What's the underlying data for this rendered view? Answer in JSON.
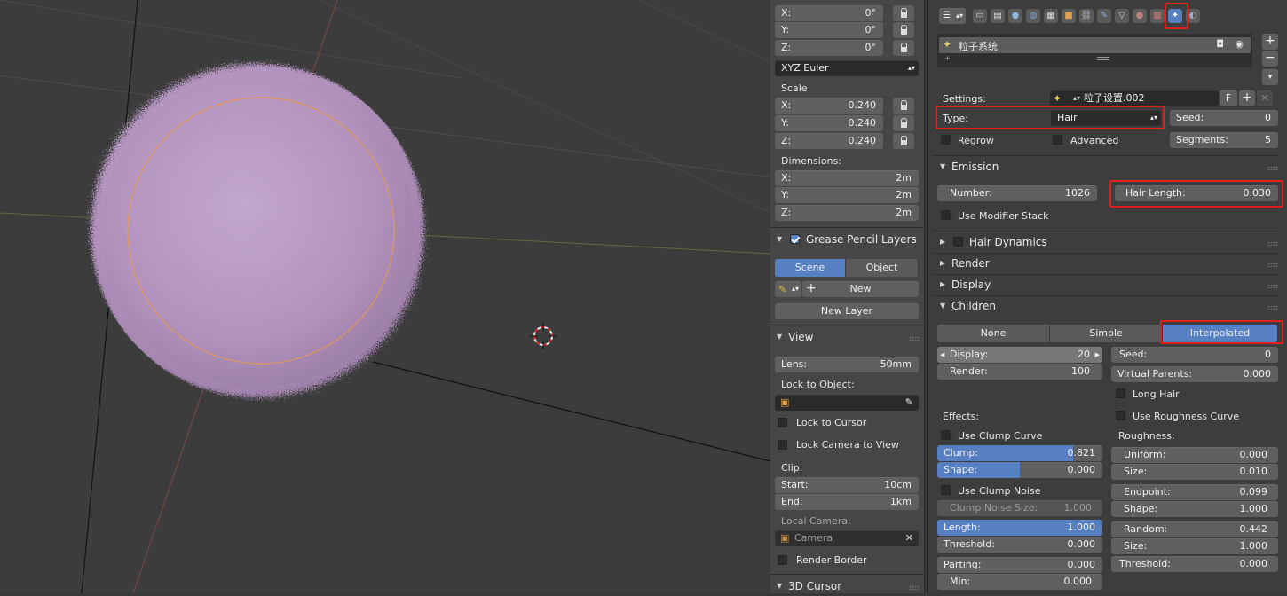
{
  "npanel": {
    "rotation": {
      "x_label": "X:",
      "x": "0°",
      "y_label": "Y:",
      "y": "0°",
      "z_label": "Z:",
      "z": "0°",
      "mode": "XYZ Euler"
    },
    "scale": {
      "title": "Scale:",
      "x_label": "X:",
      "x": "0.240",
      "y_label": "Y:",
      "y": "0.240",
      "z_label": "Z:",
      "z": "0.240"
    },
    "dimensions": {
      "title": "Dimensions:",
      "x_label": "X:",
      "x": "2m",
      "y_label": "Y:",
      "y": "2m",
      "z_label": "Z:",
      "z": "2m"
    },
    "grease": {
      "title": "Grease Pencil Layers",
      "scene": "Scene",
      "object": "Object",
      "new": "New",
      "new_layer": "New Layer"
    },
    "view": {
      "title": "View",
      "lens_label": "Lens:",
      "lens": "50mm",
      "lock_to_object": "Lock to Object:",
      "lock_cursor": "Lock to Cursor",
      "lock_camera": "Lock Camera to View",
      "clip": "Clip:",
      "start_label": "Start:",
      "start": "10cm",
      "end_label": "End:",
      "end": "1km",
      "local_camera": "Local Camera:",
      "camera": "Camera",
      "render_border": "Render Border"
    },
    "cursor": {
      "title": "3D Cursor"
    }
  },
  "props": {
    "particle_system_name": "粒子系统",
    "settings_label": "Settings:",
    "settings_value": "粒子设置.002",
    "settings_f": "F",
    "type_label": "Type:",
    "type_value": "Hair",
    "seed_label": "Seed:",
    "seed_value": "0",
    "regrow": "Regrow",
    "advanced": "Advanced",
    "segments_label": "Segments:",
    "segments_value": "5",
    "emission": {
      "title": "Emission",
      "number_label": "Number:",
      "number": "1026",
      "hair_length_label": "Hair Length:",
      "hair_length": "0.030",
      "use_modifier_stack": "Use Modifier Stack"
    },
    "hair_dynamics": "Hair Dynamics",
    "render": "Render",
    "display": "Display",
    "children": {
      "title": "Children",
      "tabs": [
        "None",
        "Simple",
        "Interpolated"
      ],
      "display_label": "Display:",
      "display": "20",
      "render_label": "Render:",
      "render": "100",
      "seed_label": "Seed:",
      "seed": "0",
      "virtual_parents_label": "Virtual Parents:",
      "virtual_parents": "0.000",
      "long_hair": "Long Hair",
      "use_roughness_curve": "Use Roughness Curve",
      "effects": "Effects:",
      "use_clump_curve": "Use Clump Curve",
      "clump_label": "Clump:",
      "clump": "0.821",
      "shape_label": "Shape:",
      "shape": "0.000",
      "use_clump_noise": "Use Clump Noise",
      "clump_noise_size_label": "Clump Noise Size:",
      "clump_noise_size": "1.000",
      "length_label": "Length:",
      "length": "1.000",
      "threshold_label": "Threshold:",
      "threshold": "0.000",
      "parting_label": "Parting:",
      "parting": "0.000",
      "min_label": "Min:",
      "min": "0.000",
      "roughness": "Roughness:",
      "uniform_label": "Uniform:",
      "uniform": "0.000",
      "size_label": "Size:",
      "size": "0.010",
      "endpoint_label": "Endpoint:",
      "endpoint": "0.099",
      "rshape_label": "Shape:",
      "rshape": "1.000",
      "random_label": "Random:",
      "random": "0.442",
      "rsize_label": "Size:",
      "rsize": "1.000",
      "rthreshold_label": "Threshold:",
      "rthreshold": "0.000"
    }
  },
  "colors": {
    "accent": "#5680c2",
    "highlight": "#e0211b",
    "hair": "#b89ac2"
  }
}
